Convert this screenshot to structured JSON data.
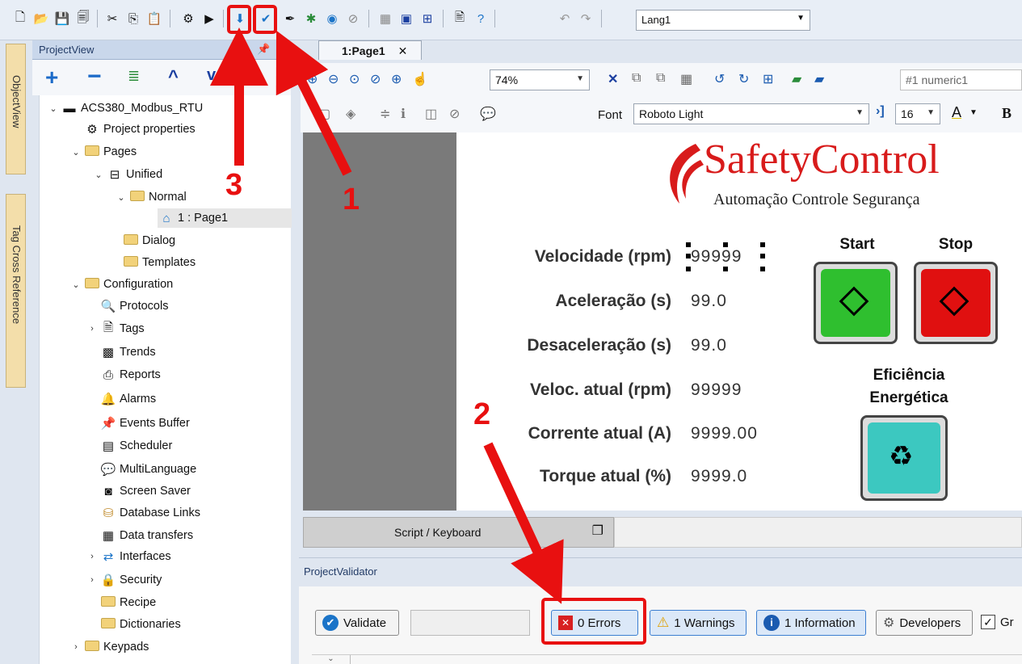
{
  "toolbar": {
    "language": "Lang1"
  },
  "side_tabs": [
    "ObjectView",
    "Tag Cross Reference"
  ],
  "project_view": {
    "title": "ProjectView",
    "tree": [
      {
        "label": "ACS380_Modbus_RTU"
      },
      {
        "label": "Project properties"
      },
      {
        "label": "Pages"
      },
      {
        "label": "Unified"
      },
      {
        "label": "Normal"
      },
      {
        "label": "1 : Page1"
      },
      {
        "label": "Dialog"
      },
      {
        "label": "Templates"
      },
      {
        "label": "Configuration"
      },
      {
        "label": "Protocols"
      },
      {
        "label": "Tags"
      },
      {
        "label": "Trends"
      },
      {
        "label": "Reports"
      },
      {
        "label": "Alarms"
      },
      {
        "label": "Events Buffer"
      },
      {
        "label": "Scheduler"
      },
      {
        "label": "MultiLanguage"
      },
      {
        "label": "Screen Saver"
      },
      {
        "label": "Database Links"
      },
      {
        "label": "Data transfers"
      },
      {
        "label": "Interfaces"
      },
      {
        "label": "Security"
      },
      {
        "label": "Recipe"
      },
      {
        "label": "Dictionaries"
      },
      {
        "label": "Keypads"
      }
    ]
  },
  "editor": {
    "tab": "1:Page1",
    "zoom": "74%",
    "selection": "#1 numeric1",
    "font_label": "Font",
    "font": "Roboto Light",
    "font_size": "16",
    "bold": "B"
  },
  "hmi": {
    "logo_main": "SafetyControl",
    "logo_sub": "Automação Controle Segurança",
    "fields": [
      {
        "label": "Velocidade (rpm)",
        "value": "99999"
      },
      {
        "label": "Aceleração (s)",
        "value": "99.0"
      },
      {
        "label": "Desaceleração (s)",
        "value": "99.0"
      },
      {
        "label": "Veloc. atual (rpm)",
        "value": "99999"
      },
      {
        "label": "Corrente atual (A)",
        "value": "9999.00"
      },
      {
        "label": "Torque atual (%)",
        "value": "9999.0"
      }
    ],
    "start_label": "Start",
    "stop_label": "Stop",
    "eff_label_1": "Eficiência",
    "eff_label_2": "Energética"
  },
  "script_bar": {
    "label": "Script / Keyboard"
  },
  "validator": {
    "title": "ProjectValidator",
    "validate": "Validate",
    "errors": "0 Errors",
    "warnings": "1 Warnings",
    "information": "1 Information",
    "developers": "Developers",
    "group": "Gr"
  },
  "annotations": [
    "1",
    "2",
    "3"
  ],
  "colors": {
    "annotation": "#e81010",
    "start": "#2fbf2f",
    "stop": "#e01010",
    "eco": "#3cc8c0"
  }
}
